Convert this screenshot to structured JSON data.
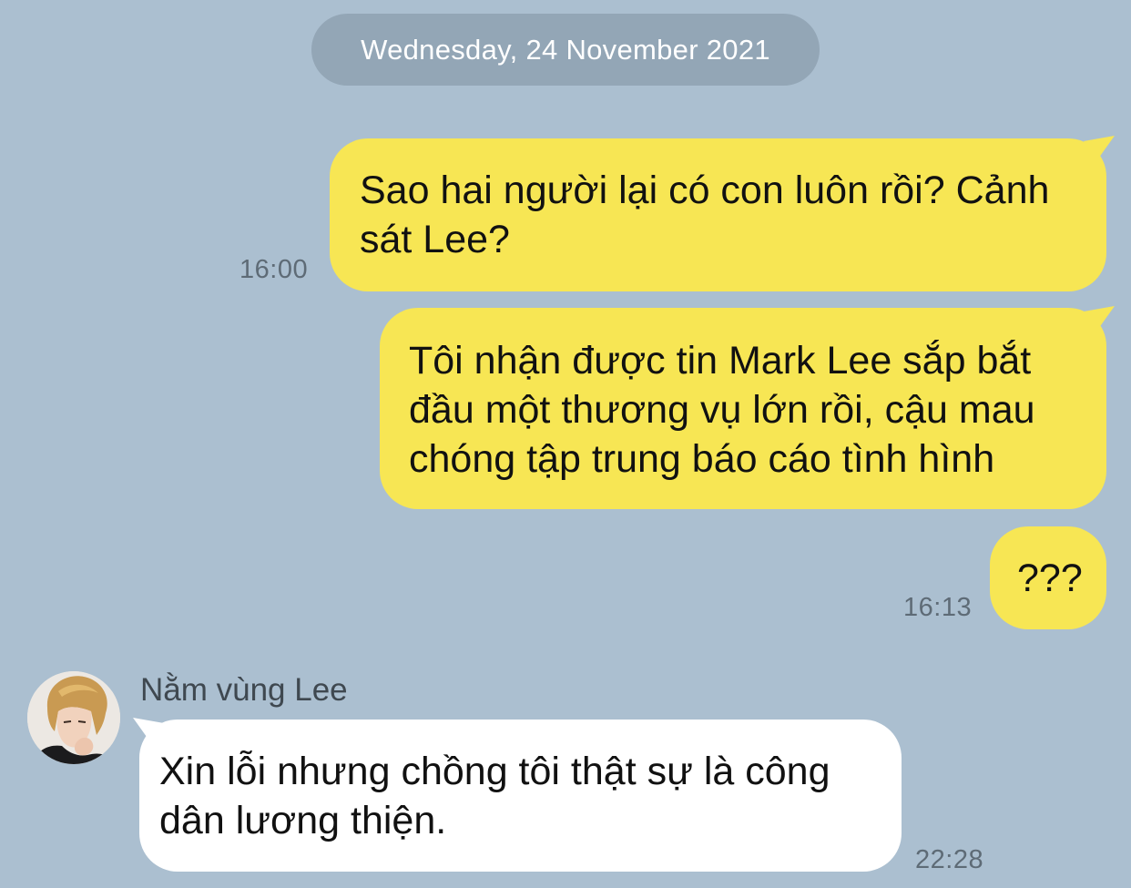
{
  "chat": {
    "date_separator": "Wednesday, 24 November 2021",
    "messages": [
      {
        "direction": "outgoing",
        "text": "Sao hai người lại có con luôn rồi? Cảnh sát Lee?",
        "time": "16:00"
      },
      {
        "direction": "outgoing",
        "text": "Tôi nhận được tin Mark Lee sắp bắt đầu một thương vụ lớn rồi, cậu mau chóng tập trung báo cáo tình hình",
        "time": ""
      },
      {
        "direction": "outgoing",
        "text": "???",
        "time": "16:13"
      },
      {
        "direction": "incoming",
        "sender": "Nằm vùng Lee",
        "text": "Xin lỗi nhưng chồng tôi thật sự là công dân lương thiện.",
        "time": "22:28"
      }
    ]
  },
  "colors": {
    "background": "#abbfd0",
    "outgoing_bubble": "#f7e654",
    "incoming_bubble": "#ffffff",
    "date_pill": "#93a6b6"
  }
}
